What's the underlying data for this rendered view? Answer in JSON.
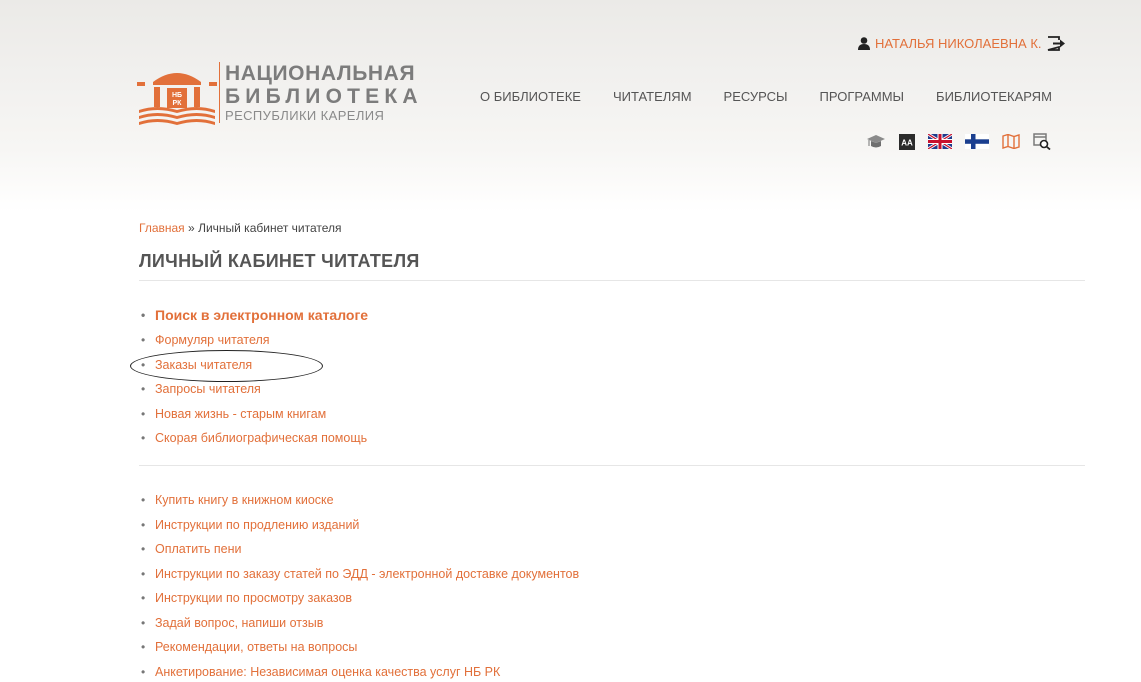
{
  "logo": {
    "line1": "НАЦИОНАЛЬНАЯ",
    "line2": "БИБЛИОТЕКА",
    "line3": "РЕСПУБЛИКИ КАРЕЛИЯ",
    "emblem_text": "НБ РК"
  },
  "user": {
    "name": "НАТАЛЬЯ НИКОЛАЕВНА К."
  },
  "nav": [
    "О БИБЛИОТЕКЕ",
    "ЧИТАТЕЛЯМ",
    "РЕСУРСЫ",
    "ПРОГРАММЫ",
    "БИБЛИОТЕКАРЯМ"
  ],
  "tools": {
    "icons": [
      "graduation-cap-icon",
      "font-size-icon",
      "uk-flag-icon",
      "finland-flag-icon",
      "map-icon",
      "search-catalog-icon"
    ],
    "font_label": "AA"
  },
  "breadcrumb": {
    "home": "Главная",
    "separator": "»",
    "current": "Личный кабинет читателя"
  },
  "page_title": "ЛИЧНЫЙ КАБИНЕТ ЧИТАТЕЛЯ",
  "links_primary": [
    "Поиск в электронном каталоге",
    "Формуляр читателя",
    "Заказы читателя",
    "Запросы читателя",
    "Новая жизнь - старым книгам",
    "Скорая библиографическая помощь"
  ],
  "links_secondary": [
    "Купить книгу в книжном киоске",
    "Инструкции по продлению изданий",
    "Оплатить пени",
    "Инструкции по заказу статей по ЭДД - электронной доставке документов",
    "Инструкции по просмотру заказов",
    "Задай вопрос, напиши отзыв",
    "Рекомендации, ответы на вопросы",
    "Анкетирование: Независимая оценка качества услуг НБ РК"
  ],
  "colors": {
    "accent": "#e2703a",
    "text": "#555555",
    "divider": "#e6e6e6"
  }
}
